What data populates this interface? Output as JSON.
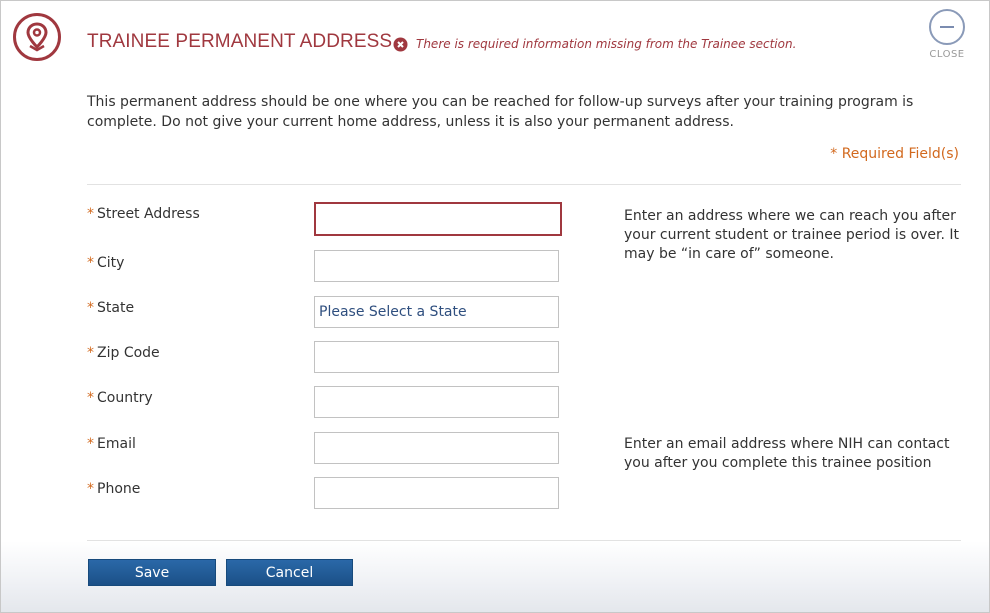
{
  "header": {
    "title": "TRAINEE PERMANENT ADDRESS",
    "error_message": "There is required information missing from the Trainee section.",
    "close_label": "CLOSE"
  },
  "intro_text": "This permanent address should be one where you can be reached for follow-up surveys after your training program is complete. Do not give your current home address, unless it is also your permanent address.",
  "required_note": "* Required Field(s)",
  "form": {
    "required_marker": "*",
    "street_address": {
      "label": "Street Address",
      "value": ""
    },
    "city": {
      "label": "City",
      "value": ""
    },
    "state": {
      "label": "State",
      "selected": "Please Select a State"
    },
    "zip_code": {
      "label": "Zip Code",
      "value": ""
    },
    "country": {
      "label": "Country",
      "value": ""
    },
    "email": {
      "label": "Email",
      "value": ""
    },
    "phone": {
      "label": "Phone",
      "value": ""
    }
  },
  "help": {
    "address": "Enter an address where we can reach you after your current student or trainee period is over. It may be “in care of” someone.",
    "email": "Enter an email address where NIH can contact you after you complete this trainee position"
  },
  "buttons": {
    "save": "Save",
    "cancel": "Cancel"
  },
  "colors": {
    "accent": "#a0383f",
    "required": "#d2691e",
    "button": "#1b5087"
  },
  "icons": {
    "header": "location-pin-icon",
    "error": "error-x-icon",
    "close": "minus-circle-icon"
  }
}
